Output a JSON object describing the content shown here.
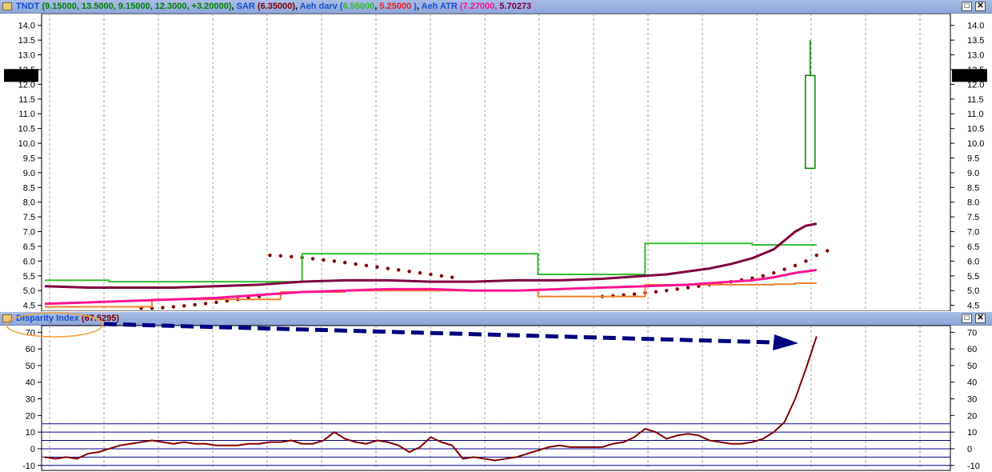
{
  "price_pane": {
    "header": {
      "symbol": "TNDT",
      "ohlc": "(9.15000, 13.5000, 9.15000, 12.3000, +3.20000)",
      "sar_label": "SAR",
      "sar_value": "(6.35000)",
      "darv_label": "Aeh darv",
      "darv_open": "(",
      "darv_v1": "6.55000",
      "darv_v2": "5.25000",
      "darv_close": ")",
      "atr_label": "Aeh ATR",
      "atr_v1": "(7.27000,",
      "atr_v2": "5.70273"
    },
    "last_price_tag": "12.3000",
    "colors": {
      "header_symbol": "#1a4fd0",
      "header_ohlc": "#008000",
      "sar": "#800000",
      "darv_green": "#33bb33",
      "darv_red": "#ee2222",
      "atr_pink": "#ff1493",
      "atr_purple": "#800040"
    }
  },
  "indicator_pane": {
    "header": {
      "name": "Disparity Index",
      "value": "(67.5295)"
    },
    "colors": {
      "line": "#800000",
      "levels": "#000080",
      "arrow": "#000080",
      "highlight": "#f0a040"
    }
  },
  "window_buttons": {
    "restore": "□",
    "close": "✕"
  },
  "chart_data": [
    {
      "type": "candlestick",
      "title": "TNDT",
      "ylim": [
        4.3,
        14.4
      ],
      "yticks": [
        "4.5",
        "5.0",
        "5.5",
        "6.0",
        "6.5",
        "7.0",
        "7.5",
        "8.0",
        "8.5",
        "9.0",
        "9.5",
        "10.0",
        "10.5",
        "11.0",
        "11.5",
        "12.0",
        "12.5",
        "13.0",
        "13.5",
        "14.0"
      ],
      "grid": true,
      "last_close": 12.3,
      "last_candle": {
        "open": 9.15,
        "high": 13.5,
        "low": 9.15,
        "close": 12.3
      },
      "series": [
        {
          "name": "SAR",
          "kind": "dots",
          "x": [
            9,
            10,
            11,
            12,
            13,
            14,
            15,
            16,
            17,
            18,
            19,
            20,
            21,
            22,
            23,
            24,
            25,
            26,
            27,
            28,
            29,
            30,
            31,
            32,
            33,
            34,
            35,
            36,
            37,
            38,
            52,
            53,
            54,
            55,
            56,
            57,
            58,
            59,
            60,
            61,
            62,
            63,
            64,
            65,
            66,
            67,
            68,
            69,
            70,
            71,
            72,
            73
          ],
          "values": [
            4.4,
            4.4,
            4.42,
            4.45,
            4.48,
            4.52,
            4.56,
            4.6,
            4.65,
            4.7,
            4.75,
            4.8,
            6.2,
            6.18,
            6.15,
            6.12,
            6.08,
            6.04,
            6.0,
            5.95,
            5.9,
            5.85,
            5.8,
            5.75,
            5.7,
            5.65,
            5.6,
            5.55,
            5.5,
            5.45,
            4.8,
            4.82,
            4.85,
            4.88,
            4.92,
            4.96,
            5.0,
            5.05,
            5.1,
            5.15,
            5.2,
            5.25,
            5.3,
            5.36,
            5.42,
            5.5,
            5.6,
            5.72,
            5.85,
            6.0,
            6.2,
            6.35
          ]
        },
        {
          "name": "Aeh darv upper",
          "kind": "line",
          "x": [
            0,
            2,
            4,
            6,
            8,
            10,
            12,
            14,
            16,
            18,
            20,
            22,
            24,
            26,
            28,
            30,
            32,
            34,
            36,
            38,
            40,
            42,
            44,
            46,
            48,
            50,
            52,
            54,
            56,
            58,
            60,
            62,
            64,
            66,
            68,
            70,
            72
          ],
          "values": [
            5.35,
            5.35,
            5.35,
            5.3,
            5.3,
            5.3,
            5.3,
            5.3,
            5.3,
            5.3,
            5.3,
            5.3,
            6.25,
            6.25,
            6.25,
            6.25,
            6.25,
            6.25,
            6.25,
            6.25,
            6.25,
            6.25,
            6.25,
            5.55,
            5.55,
            5.55,
            5.55,
            5.55,
            6.6,
            6.6,
            6.6,
            6.6,
            6.6,
            6.55,
            6.55,
            6.55,
            6.55
          ]
        },
        {
          "name": "Aeh darv lower",
          "kind": "line",
          "x": [
            0,
            4,
            8,
            10,
            12,
            14,
            16,
            18,
            20,
            22,
            24,
            26,
            28,
            30,
            32,
            34,
            36,
            38,
            40,
            42,
            44,
            46,
            48,
            50,
            52,
            54,
            56,
            58,
            60,
            62,
            64,
            66,
            68,
            70,
            72
          ],
          "values": [
            4.45,
            4.45,
            4.45,
            4.7,
            4.7,
            4.7,
            4.7,
            4.7,
            4.7,
            4.95,
            4.95,
            4.95,
            5.0,
            5.0,
            5.0,
            5.0,
            5.0,
            5.0,
            5.0,
            5.0,
            5.0,
            4.8,
            4.8,
            4.8,
            4.8,
            4.8,
            5.2,
            5.2,
            5.2,
            5.2,
            5.2,
            5.2,
            5.22,
            5.25,
            5.25
          ]
        },
        {
          "name": "Aeh ATR upper",
          "kind": "line",
          "x": [
            0,
            4,
            8,
            12,
            16,
            20,
            24,
            28,
            32,
            36,
            40,
            44,
            48,
            52,
            56,
            58,
            60,
            62,
            64,
            66,
            68,
            69,
            70,
            71,
            72
          ],
          "values": [
            5.15,
            5.1,
            5.1,
            5.1,
            5.15,
            5.2,
            5.3,
            5.35,
            5.35,
            5.3,
            5.3,
            5.35,
            5.35,
            5.4,
            5.5,
            5.55,
            5.65,
            5.75,
            5.9,
            6.1,
            6.4,
            6.7,
            7.0,
            7.2,
            7.27
          ]
        },
        {
          "name": "Aeh ATR lower",
          "kind": "line",
          "x": [
            0,
            4,
            8,
            12,
            16,
            20,
            24,
            28,
            32,
            36,
            40,
            44,
            48,
            52,
            56,
            60,
            64,
            66,
            68,
            70,
            72
          ],
          "values": [
            4.55,
            4.6,
            4.65,
            4.7,
            4.75,
            4.85,
            4.95,
            5.0,
            5.05,
            5.05,
            5.0,
            5.0,
            5.05,
            5.1,
            5.15,
            5.2,
            5.3,
            5.35,
            5.45,
            5.6,
            5.7
          ]
        }
      ]
    },
    {
      "type": "line",
      "title": "Disparity Index",
      "ylim": [
        -13,
        74
      ],
      "yticks": [
        -10,
        0,
        10,
        20,
        30,
        40,
        50,
        60,
        70
      ],
      "levels": [
        15,
        10,
        5,
        0,
        -5,
        -10
      ],
      "grid": true,
      "last_value": 67.5295,
      "series": [
        {
          "name": "Disparity Index",
          "x": [
            0,
            1,
            2,
            3,
            4,
            5,
            6,
            7,
            8,
            9,
            10,
            11,
            12,
            13,
            14,
            15,
            16,
            17,
            18,
            19,
            20,
            21,
            22,
            23,
            24,
            25,
            26,
            27,
            28,
            29,
            30,
            31,
            32,
            33,
            34,
            35,
            36,
            37,
            38,
            39,
            40,
            41,
            42,
            43,
            44,
            45,
            46,
            47,
            48,
            49,
            50,
            51,
            52,
            53,
            54,
            55,
            56,
            57,
            58,
            59,
            60,
            61,
            62,
            63,
            64,
            65,
            66,
            67,
            68,
            69,
            70,
            71,
            72
          ],
          "values": [
            -5,
            -6,
            -5,
            -6,
            -3,
            -2,
            0,
            2,
            3,
            4,
            5,
            4,
            3,
            4,
            3,
            3,
            2,
            2,
            2,
            3,
            3,
            4,
            4,
            5,
            3,
            3,
            5,
            10,
            6,
            4,
            3,
            5,
            4,
            2,
            -2,
            1,
            7,
            4,
            2,
            -6,
            -5,
            -6,
            -7,
            -6,
            -5,
            -3,
            -1,
            1,
            2,
            1,
            1,
            1,
            1,
            3,
            4,
            7,
            12,
            10,
            6,
            8,
            9,
            8,
            5,
            4,
            3,
            3,
            4,
            6,
            10,
            16,
            30,
            48,
            67.53
          ]
        }
      ]
    }
  ]
}
